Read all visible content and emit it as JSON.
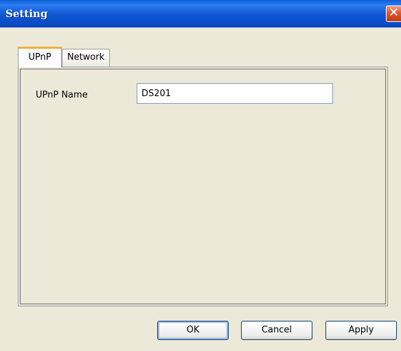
{
  "window": {
    "title": "Setting",
    "close_icon": "close-icon"
  },
  "tabs": [
    {
      "label": "UPnP",
      "active": true
    },
    {
      "label": "Network",
      "active": false
    }
  ],
  "form": {
    "upnp_name_label": "UPnP Name",
    "upnp_name_value": "DS201"
  },
  "buttons": {
    "ok": "OK",
    "cancel": "Cancel",
    "apply": "Apply"
  },
  "colors": {
    "titlebar": "#0a5fd8",
    "active_tab_accent": "#f0b030",
    "window_background": "#ece9d8"
  }
}
